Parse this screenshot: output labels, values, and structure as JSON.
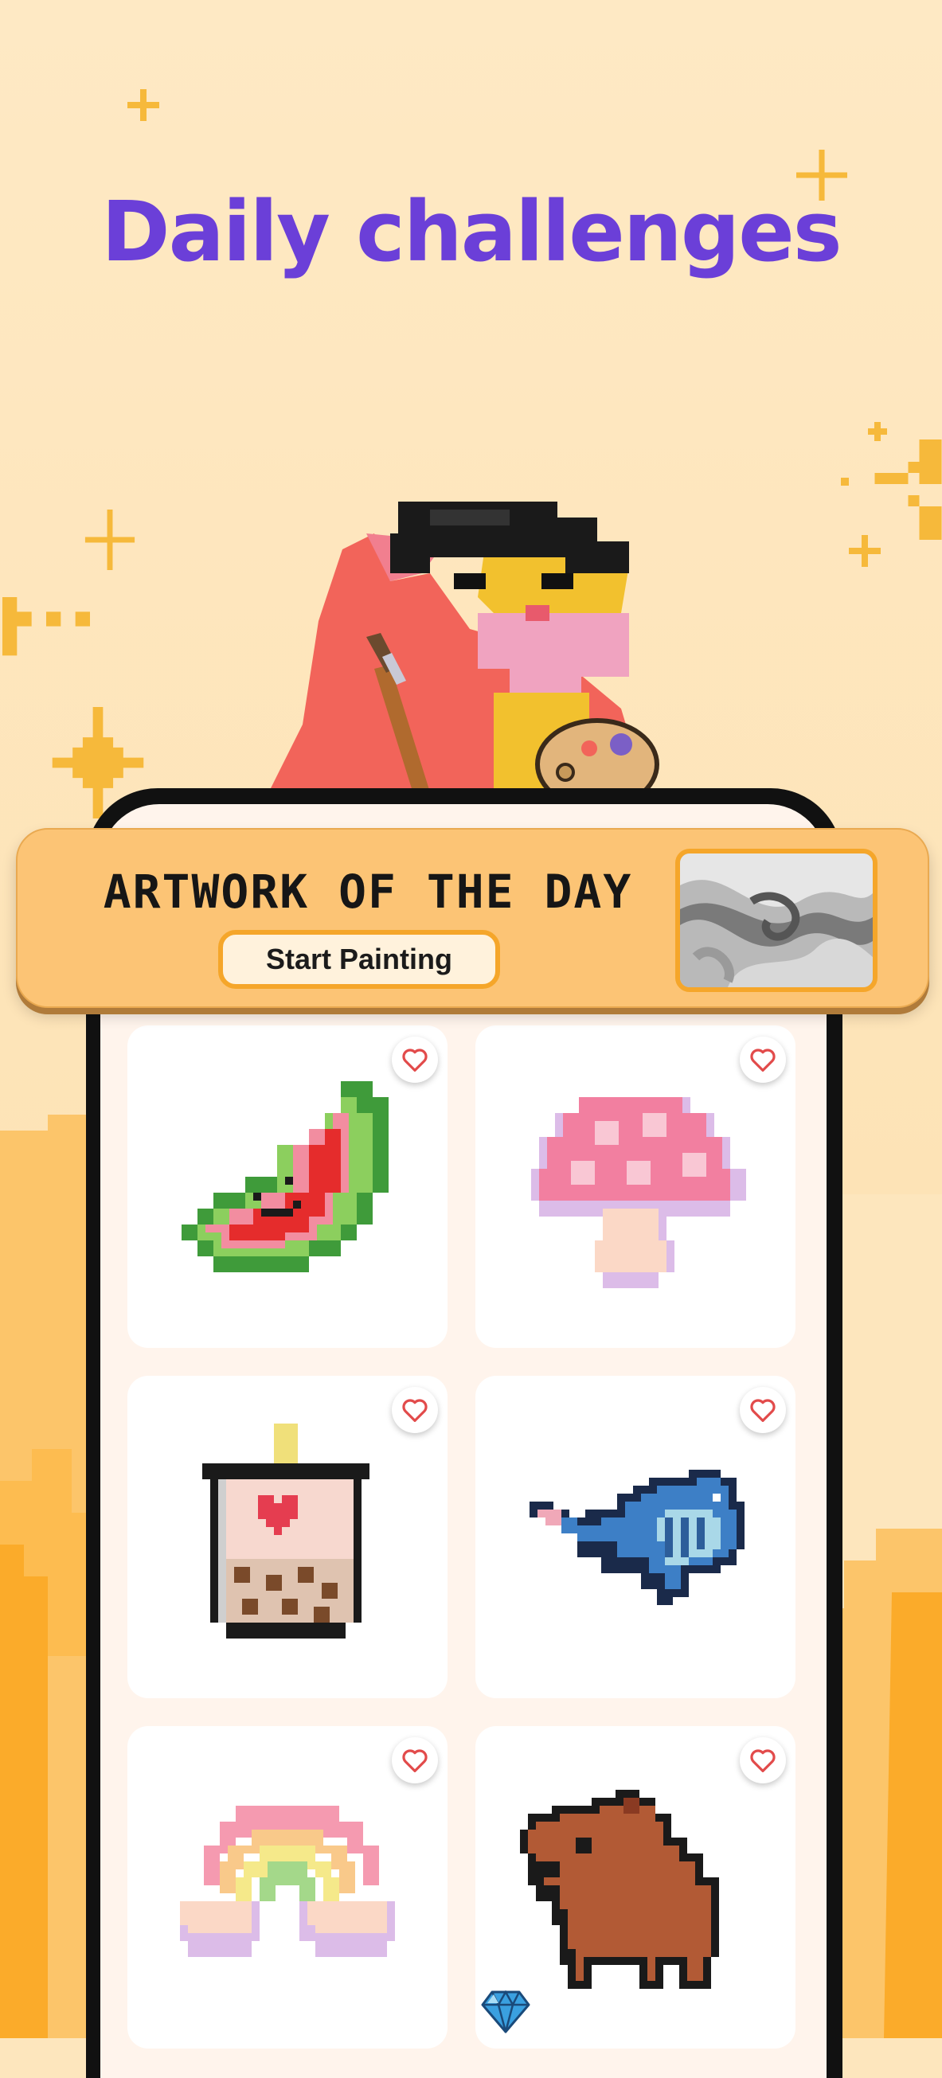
{
  "headline": "Daily challenges",
  "banner": {
    "title": "ARTWORK OF THE DAY",
    "button_label": "Start Painting",
    "thumbnail": "marble-swirl-artwork"
  },
  "artworks": [
    {
      "name": "watermelon",
      "icon": "heart-outline-icon"
    },
    {
      "name": "mushroom",
      "icon": "heart-outline-icon"
    },
    {
      "name": "bubble-tea",
      "icon": "heart-outline-icon"
    },
    {
      "name": "whale",
      "icon": "heart-outline-icon"
    },
    {
      "name": "rainbow",
      "icon": "heart-outline-icon"
    },
    {
      "name": "capybara",
      "icon": "heart-outline-icon"
    }
  ],
  "colors": {
    "headline": "#6b3fd8",
    "banner": "#fcc475",
    "accent": "#f5a62a",
    "heart": "#e24b4b"
  }
}
